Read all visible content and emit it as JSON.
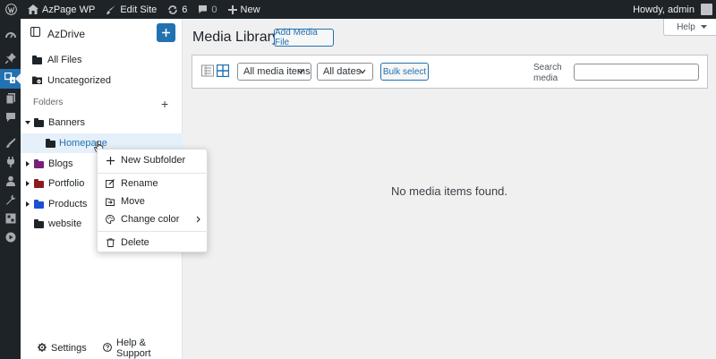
{
  "admin_bar": {
    "site_name": "AzPage WP",
    "edit_site": "Edit Site",
    "updates_count": "6",
    "comments_count": "0",
    "new_label": "New",
    "greeting": "Howdy, admin"
  },
  "admin_menu": {
    "icons": [
      "dashboard-icon",
      "pin-icon",
      "media-icon",
      "pages-icon",
      "comments-icon",
      "appearance-icon",
      "plugins-icon",
      "users-icon",
      "tools-icon",
      "settings-icon",
      "media-player-icon"
    ]
  },
  "azdrive": {
    "title": "AzDrive",
    "all_files": "All Files",
    "uncategorized": "Uncategorized",
    "folders_label": "Folders",
    "folders": [
      {
        "label": "Banners",
        "color": "#1d2327"
      },
      {
        "label": "Homepage",
        "color": "#1d2327"
      },
      {
        "label": "Blogs",
        "color": "#7a1f7a"
      },
      {
        "label": "Portfolio",
        "color": "#8a1c1c"
      },
      {
        "label": "Products",
        "color": "#1a4fd6"
      },
      {
        "label": "website",
        "color": "#1d2327"
      }
    ],
    "footer": {
      "settings": "Settings",
      "help": "Help & Support"
    }
  },
  "context_menu": {
    "new_subfolder": "New Subfolder",
    "rename": "Rename",
    "move": "Move",
    "change_color": "Change color",
    "delete": "Delete"
  },
  "main": {
    "help_label": "Help",
    "page_title": "Media Library",
    "add_media_label": "Add Media File",
    "filter_type": "All media items",
    "filter_date": "All dates",
    "bulk_select": "Bulk select",
    "search_label": "Search media",
    "empty_message": "No media items found."
  },
  "colors": {
    "accent": "#2271b1",
    "admin_bar_bg": "#1d2327",
    "selected_row_bg": "#e5f0fa"
  }
}
